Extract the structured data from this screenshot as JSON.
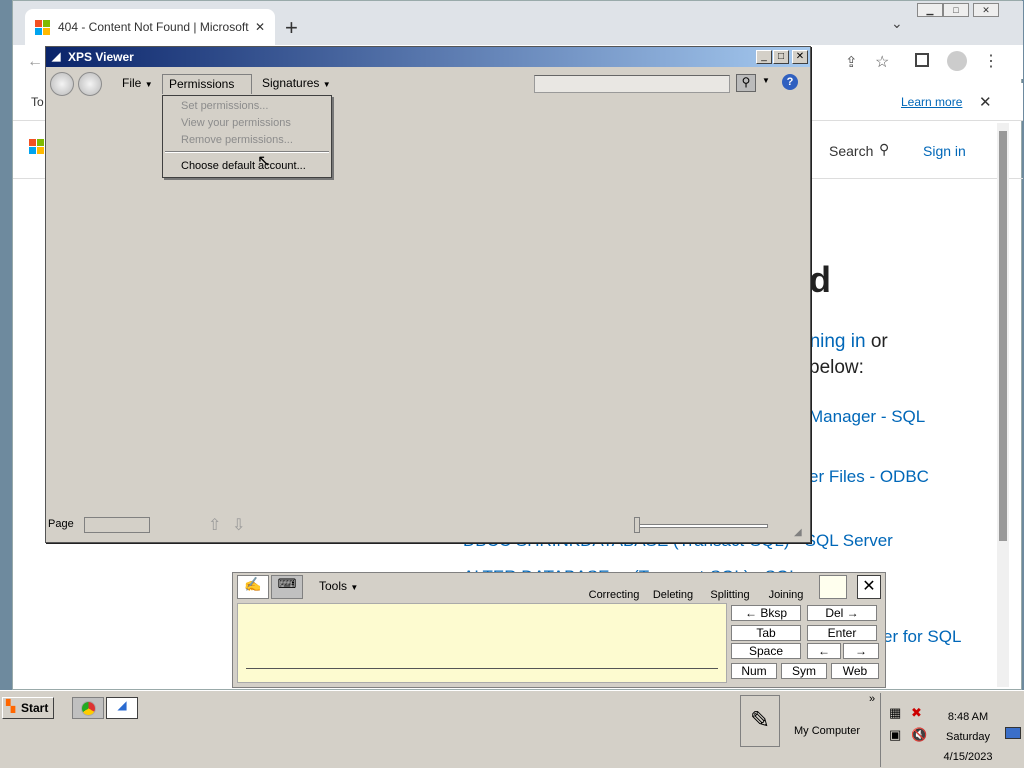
{
  "chrome": {
    "tab_title": "404 - Content Not Found | Microsoft",
    "infobar_prefix": "To",
    "learn_more": "Learn more",
    "search_label": "Search",
    "signin": "Sign in",
    "heading_fragment": "d",
    "text1_link": "gning in",
    "text1_rest": "or",
    "text2": "below:",
    "links": [
      "Manager - SQL",
      "er Files - ODBC",
      "DBCC SHRINKDATABASE (Transact-SQL) - SQL Server",
      "ALTER DATABASE ... (Transact-SQL) - SQL",
      "er for SQL"
    ]
  },
  "xps": {
    "title": "XPS Viewer",
    "menu": {
      "file": "File",
      "permissions": "Permissions",
      "signatures": "Signatures"
    },
    "dropdown": {
      "set": "Set permissions...",
      "view": "View your permissions",
      "remove": "Remove permissions...",
      "choose": "Choose default account..."
    },
    "page_label": "Page"
  },
  "tip": {
    "tools": "Tools",
    "correcting": "Correcting",
    "deleting": "Deleting",
    "splitting": "Splitting",
    "joining": "Joining",
    "keys": {
      "bksp": "←   Bksp",
      "del": "Del   →",
      "tab": "Tab",
      "enter": "Enter",
      "space": "Space",
      "left": "←",
      "right": "→",
      "num": "Num",
      "sym": "Sym",
      "web": "Web"
    }
  },
  "taskbar": {
    "start": "Start",
    "my_computer": "My Computer",
    "time": "8:48 AM",
    "day": "Saturday",
    "date": "4/15/2023"
  },
  "colors": {
    "accent": "#0067b8",
    "titlebar": "#0a246a"
  }
}
